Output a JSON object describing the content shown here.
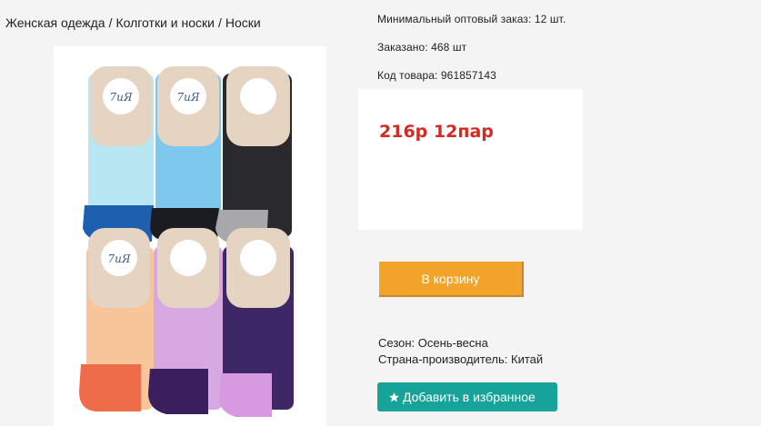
{
  "breadcrumb": {
    "items": [
      "Женская одежда",
      "Колготки и носки",
      "Носки"
    ],
    "separator": "/"
  },
  "product": {
    "min_order": "Минимальный оптовый заказ: 12 шт.",
    "ordered": "Заказано: 468 шт",
    "sku": "Код товара: 961857143",
    "price": "216р 12пар",
    "cart_button": "В корзину",
    "season": "Сезон: Осень-весна",
    "country": "Страна-производитель: Китай",
    "favorite_button": "Добавить в избранное",
    "favorite_icon": "star-icon",
    "tag_brand": "7иЯ"
  },
  "colors": {
    "price": "#d42a26",
    "cart_button": "#f2a42a",
    "favorite_button": "#18a39a"
  }
}
